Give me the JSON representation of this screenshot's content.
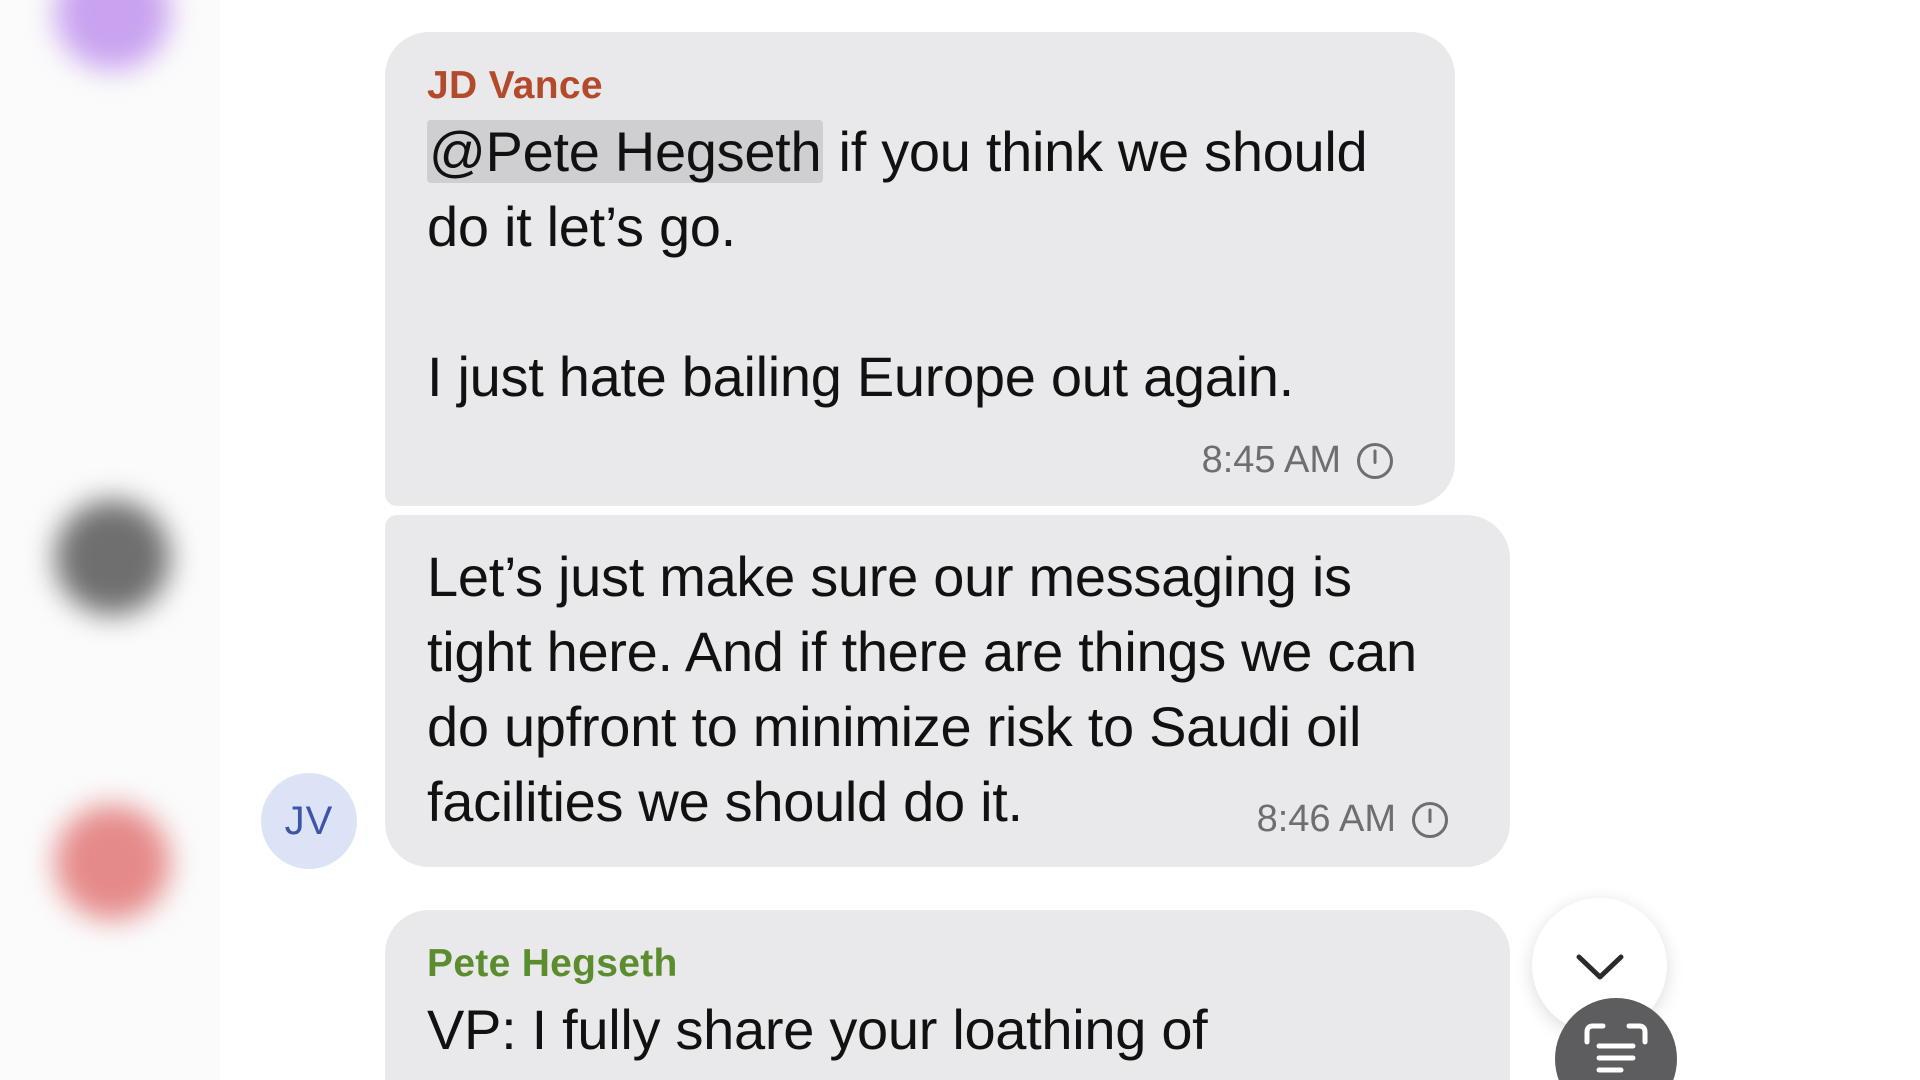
{
  "messages": [
    {
      "sender": "JD Vance",
      "mention": "@Pete Hegseth",
      "text_after_mention": " if you think we should do it let’s go.\n\nI just hate bailing Europe out again.",
      "time": "8:45 AM"
    },
    {
      "text": "Let’s just make sure our messaging is tight here. And if there are things we can do upfront to minimize risk to Saudi oil facilities we should do it.",
      "time": "8:46 AM",
      "avatar_initials": "JV"
    },
    {
      "sender": "Pete Hegseth",
      "text": "VP: I fully share your loathing of"
    }
  ],
  "colors": {
    "bubble": "#e9e9eb",
    "jd_name": "#b44a2c",
    "pete_name": "#5b8d2e",
    "timestamp": "#6d6d72",
    "avatar_bg": "#dde3f7",
    "avatar_text": "#3d54a8"
  },
  "icons": {
    "status": "clock-icon",
    "scroll": "chevron-down-icon",
    "scan": "text-scan-icon"
  }
}
